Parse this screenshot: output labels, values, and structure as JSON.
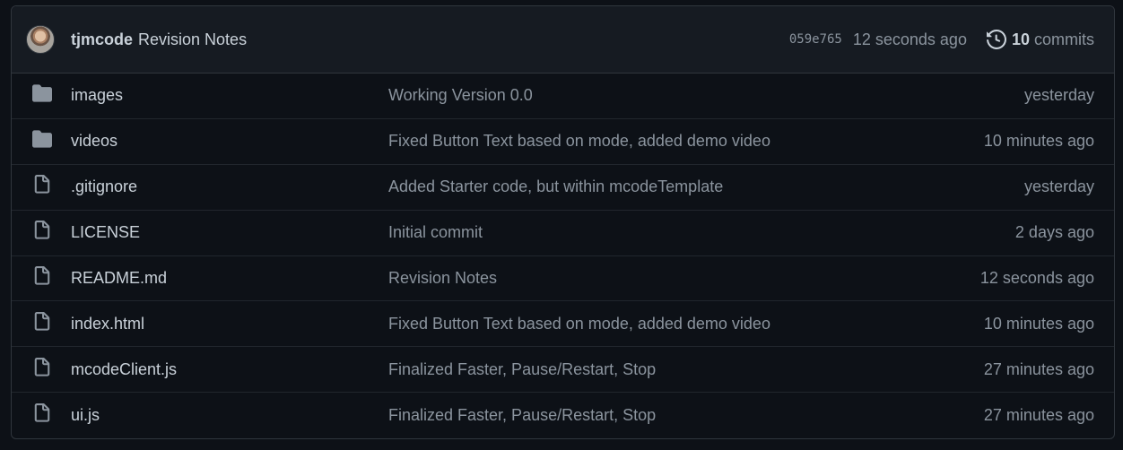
{
  "latest_commit": {
    "author": "tjmcode",
    "message": "Revision Notes",
    "sha": "059e765",
    "time": "12 seconds ago",
    "commit_count": "10",
    "commits_label": "commits"
  },
  "files": [
    {
      "type": "folder",
      "icon": "folder-icon",
      "name": "images",
      "message": "Working Version 0.0",
      "time": "yesterday"
    },
    {
      "type": "folder",
      "icon": "folder-icon",
      "name": "videos",
      "message": "Fixed Button Text based on mode, added demo video",
      "time": "10 minutes ago"
    },
    {
      "type": "file",
      "icon": "file-icon",
      "name": ".gitignore",
      "message": "Added Starter code, but within mcodeTemplate",
      "time": "yesterday"
    },
    {
      "type": "file",
      "icon": "file-icon",
      "name": "LICENSE",
      "message": "Initial commit",
      "time": "2 days ago"
    },
    {
      "type": "file",
      "icon": "file-icon",
      "name": "README.md",
      "message": "Revision Notes",
      "time": "12 seconds ago"
    },
    {
      "type": "file",
      "icon": "file-icon",
      "name": "index.html",
      "message": "Fixed Button Text based on mode, added demo video",
      "time": "10 minutes ago"
    },
    {
      "type": "file",
      "icon": "file-icon",
      "name": "mcodeClient.js",
      "message": "Finalized Faster, Pause/Restart, Stop",
      "time": "27 minutes ago"
    },
    {
      "type": "file",
      "icon": "file-icon",
      "name": "ui.js",
      "message": "Finalized Faster, Pause/Restart, Stop",
      "time": "27 minutes ago"
    }
  ],
  "colors": {
    "background": "#0d1117",
    "header_bg": "#161b22",
    "border": "#30363d",
    "text": "#c9d1d9",
    "muted": "#8b949e",
    "icon": "#8b949e"
  }
}
